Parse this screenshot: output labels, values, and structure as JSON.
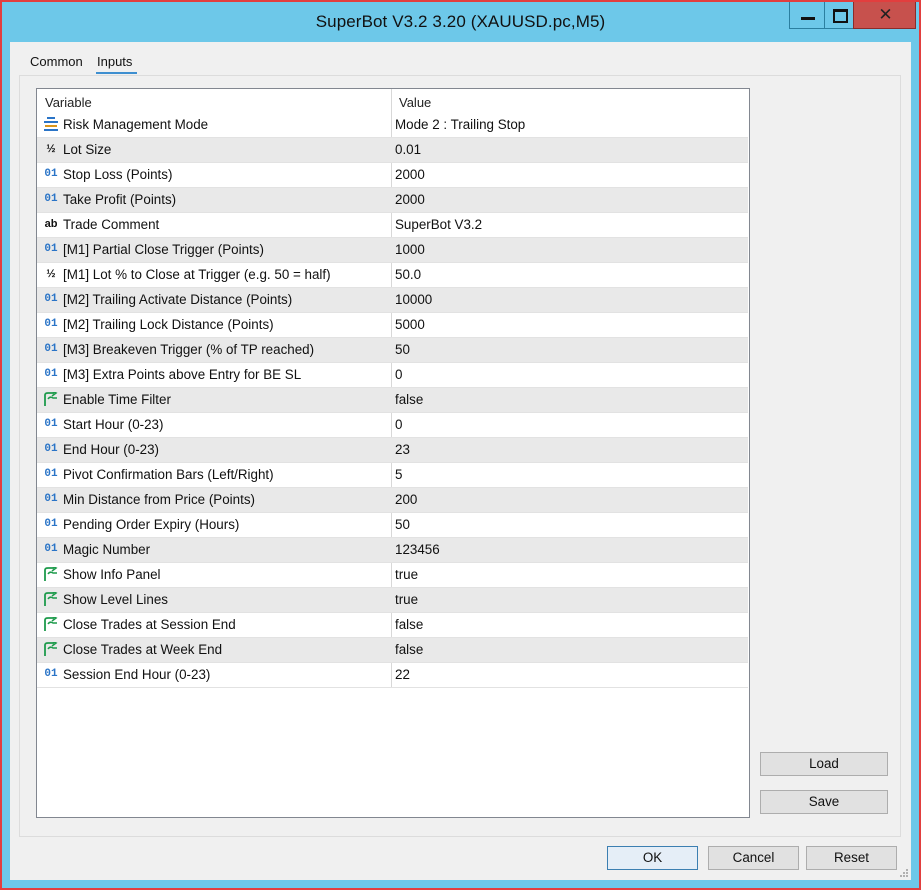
{
  "window": {
    "title": "SuperBot V3.2 3.20 (XAUUSD.pc,M5)",
    "close_glyph": "✕"
  },
  "tabs": [
    {
      "label": "Common",
      "active": false
    },
    {
      "label": "Inputs",
      "active": true
    }
  ],
  "grid": {
    "columns": {
      "variable": "Variable",
      "value": "Value"
    },
    "rows": [
      {
        "icon": "enum-icon",
        "variable": "Risk Management Mode",
        "value": "Mode 2 : Trailing Stop"
      },
      {
        "icon": "double-icon",
        "variable": "Lot Size",
        "value": "0.01"
      },
      {
        "icon": "int-icon",
        "variable": "Stop Loss (Points)",
        "value": "2000"
      },
      {
        "icon": "int-icon",
        "variable": "Take Profit (Points)",
        "value": "2000"
      },
      {
        "icon": "string-icon",
        "variable": "Trade Comment",
        "value": "SuperBot V3.2"
      },
      {
        "icon": "int-icon",
        "variable": "[M1] Partial Close Trigger (Points)",
        "value": "1000"
      },
      {
        "icon": "double-icon",
        "variable": "[M1] Lot % to Close at Trigger (e.g. 50 = half)",
        "value": "50.0"
      },
      {
        "icon": "int-icon",
        "variable": "[M2] Trailing Activate Distance (Points)",
        "value": "10000"
      },
      {
        "icon": "int-icon",
        "variable": "[M2] Trailing Lock Distance (Points)",
        "value": "5000"
      },
      {
        "icon": "int-icon",
        "variable": "[M3] Breakeven Trigger (% of TP reached)",
        "value": "50"
      },
      {
        "icon": "int-icon",
        "variable": "[M3] Extra Points above Entry for BE SL",
        "value": "0"
      },
      {
        "icon": "bool-icon",
        "variable": "Enable Time Filter",
        "value": "false"
      },
      {
        "icon": "int-icon",
        "variable": "Start Hour (0-23)",
        "value": "0"
      },
      {
        "icon": "int-icon",
        "variable": "End Hour (0-23)",
        "value": "23"
      },
      {
        "icon": "int-icon",
        "variable": "Pivot Confirmation Bars (Left/Right)",
        "value": "5"
      },
      {
        "icon": "int-icon",
        "variable": "Min Distance from Price (Points)",
        "value": "200"
      },
      {
        "icon": "int-icon",
        "variable": "Pending Order Expiry (Hours)",
        "value": "50"
      },
      {
        "icon": "int-icon",
        "variable": "Magic Number",
        "value": "123456"
      },
      {
        "icon": "bool-icon",
        "variable": "Show Info Panel",
        "value": "true"
      },
      {
        "icon": "bool-icon",
        "variable": "Show Level Lines",
        "value": "true"
      },
      {
        "icon": "bool-icon",
        "variable": "Close Trades at Session End",
        "value": "false"
      },
      {
        "icon": "bool-icon",
        "variable": "Close Trades at Week End",
        "value": "false"
      },
      {
        "icon": "int-icon",
        "variable": "Session End Hour (0-23)",
        "value": "22"
      }
    ]
  },
  "icon_glyphs": {
    "int": "01",
    "double": "½",
    "string": "ab"
  },
  "buttons": {
    "load": "Load",
    "save": "Save",
    "ok": "OK",
    "cancel": "Cancel",
    "reset": "Reset"
  },
  "colors": {
    "titlebar": "#6dc8e9",
    "close_button": "#c7514d",
    "int_icon": "#2a74c7",
    "string_icon": "#d9961c",
    "bool_icon": "#1e9b4c"
  }
}
